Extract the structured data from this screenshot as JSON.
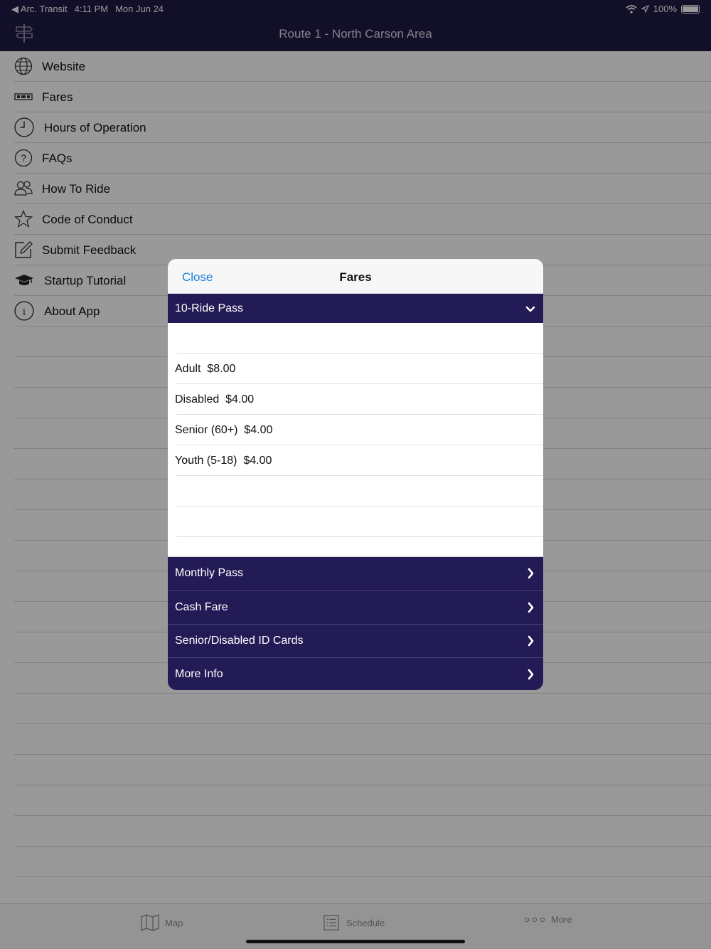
{
  "status_bar": {
    "back_app": "◀ Arc. Transit",
    "time": "4:11 PM",
    "date": "Mon Jun 24",
    "battery": "100%"
  },
  "nav": {
    "title": "Route 1 - North Carson Area"
  },
  "menu": [
    {
      "label": "Website",
      "icon": "globe-icon"
    },
    {
      "label": "Fares",
      "icon": "ticket-icon"
    },
    {
      "label": "Hours of Operation",
      "icon": "clock-icon"
    },
    {
      "label": "FAQs",
      "icon": "question-icon"
    },
    {
      "label": "How To Ride",
      "icon": "people-icon"
    },
    {
      "label": "Code of Conduct",
      "icon": "star-icon"
    },
    {
      "label": "Submit Feedback",
      "icon": "edit-icon"
    },
    {
      "label": "Startup Tutorial",
      "icon": "graduation-cap-icon"
    },
    {
      "label": "About App",
      "icon": "info-icon"
    }
  ],
  "modal": {
    "close_label": "Close",
    "title": "Fares",
    "open_section": "10-Ride Pass",
    "fares": [
      "",
      "Adult  $8.00",
      "Disabled  $4.00",
      "Senior (60+)  $4.00",
      "Youth (5-18)  $4.00",
      "",
      ""
    ],
    "sections": [
      "Monthly Pass",
      "Cash Fare",
      "Senior/Disabled ID Cards",
      "More Info"
    ]
  },
  "tabs": {
    "map": "Map",
    "schedule": "Schedule",
    "more": "More"
  },
  "colors": {
    "brand": "#231b55",
    "link": "#1a7ee0"
  }
}
